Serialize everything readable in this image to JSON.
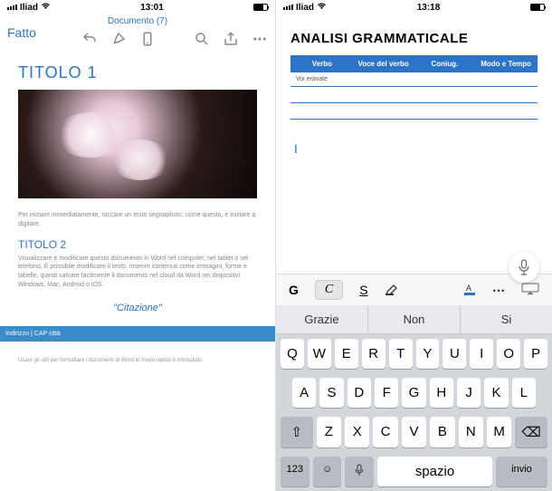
{
  "left": {
    "status": {
      "carrier": "Iliad",
      "time": "13:01"
    },
    "header": {
      "done_btn": "Fatto",
      "doc_title": "Documento (7)"
    },
    "doc": {
      "title1": "TITOLO 1",
      "para1": "Per iniziare immediatamente, toccare un testo segnaposto, come questo, e iniziare a digitare.",
      "title2": "TITOLO 2",
      "para2": "Visualizzare e modificare questo documento in Word nel computer, nel tablet o nel telefono. È possibile modificare il testo, inserire contenuti come immagini, forme e tabelle, quindi salvare facilmente il documento nel cloud da Word nei dispositivi Windows, Mac, Android o iOS.",
      "citation": "\"Citazione\"",
      "address_bar": "Indirizzo | CAP città",
      "footer": "Usare gli stili per formattare i documenti di Word in modo rapido e immediato"
    },
    "icons": {
      "undo": "undo-icon",
      "pen": "pen-icon",
      "mobile": "mobile-icon",
      "search": "search-icon",
      "share": "share-icon",
      "more": "more-icon"
    }
  },
  "right": {
    "status": {
      "carrier": "Iliad",
      "time": "13:18"
    },
    "doc": {
      "title": "ANALISI GRAMMATICALE",
      "table_headers": [
        "Verbo",
        "Voce del verbo",
        "Coniug.",
        "Modo e Tempo"
      ],
      "row1": "Voi eravate",
      "cursor": "I"
    },
    "format_bar": {
      "g": "G",
      "c": "C",
      "s": "S"
    },
    "suggestions": [
      "Grazie",
      "Non",
      "Si"
    ],
    "keys": {
      "row1": [
        "Q",
        "W",
        "E",
        "R",
        "T",
        "Y",
        "U",
        "I",
        "O",
        "P"
      ],
      "row2": [
        "A",
        "S",
        "D",
        "F",
        "G",
        "H",
        "J",
        "K",
        "L"
      ],
      "row3_shift": "⇧",
      "row3": [
        "Z",
        "X",
        "C",
        "V",
        "B",
        "N",
        "M"
      ],
      "row3_del": "⌫",
      "row4": {
        "num": "123",
        "emoji": "☺",
        "mic": "🎤",
        "space": "spazio",
        "enter": "invio"
      }
    }
  }
}
